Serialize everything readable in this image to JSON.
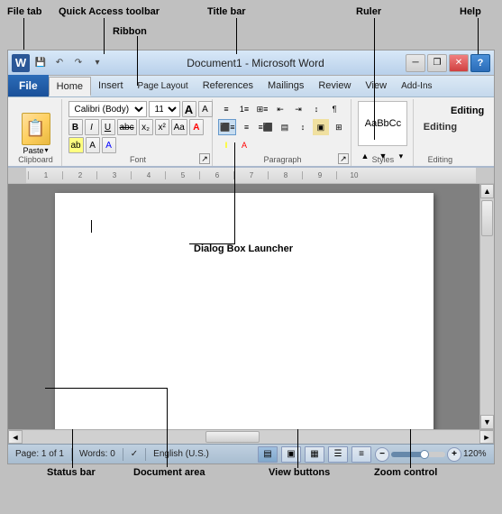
{
  "annotations": {
    "file_tab": "File tab",
    "quick_access": "Quick Access toolbar",
    "ribbon": "Ribbon",
    "title_bar": "Title bar",
    "ruler": "Ruler",
    "help": "Help",
    "dialog_box": "Dialog Box Launcher",
    "status_bar": "Status bar",
    "document_area": "Document area",
    "view_buttons": "View buttons",
    "zoom_control": "Zoom control"
  },
  "titlebar": {
    "title": "Document1 - Microsoft Word"
  },
  "quickaccess": {
    "undo_label": "↶",
    "redo_label": "↷",
    "customize_label": "▾"
  },
  "filetab": {
    "label": "File"
  },
  "ribbontabs": [
    {
      "label": "Home",
      "active": true
    },
    {
      "label": "Insert"
    },
    {
      "label": "Page Layout"
    },
    {
      "label": "References"
    },
    {
      "label": "Mailings"
    },
    {
      "label": "Review"
    },
    {
      "label": "View"
    },
    {
      "label": "Add-Ins"
    }
  ],
  "ribbon": {
    "clipboard": {
      "label": "Clipboard",
      "paste": "Paste"
    },
    "font": {
      "label": "Font",
      "font_name": "Calibri (Body)",
      "font_size": "11",
      "bold": "B",
      "italic": "I",
      "underline": "U",
      "strikethrough": "abc",
      "subscript": "x₂",
      "superscript": "x²",
      "grow": "A",
      "shrink": "A",
      "case": "Aa",
      "clear": "A",
      "color": "A"
    },
    "paragraph": {
      "label": "Paragraph"
    },
    "styles": {
      "label": "Styles",
      "normal": "AaBbCc"
    },
    "editing": {
      "label": "Editing"
    }
  },
  "ruler": {
    "ticks": [
      "1",
      "2",
      "3",
      "4",
      "5",
      "6",
      "7",
      "8",
      "9",
      "10"
    ]
  },
  "statusbar": {
    "page": "Page: 1 of 1",
    "words": "Words: 0",
    "language": "English (U.S.)",
    "zoom": "120%"
  },
  "viewbuttons": [
    {
      "icon": "▤",
      "label": "Print Layout"
    },
    {
      "icon": "▣",
      "label": "Full Screen Reading"
    },
    {
      "icon": "▦",
      "label": "Web Layout"
    },
    {
      "icon": "☰",
      "label": "Outline"
    },
    {
      "icon": "≡",
      "label": "Draft"
    }
  ],
  "wincontrols": {
    "minimize": "─",
    "restore": "❐",
    "close": "✕"
  }
}
